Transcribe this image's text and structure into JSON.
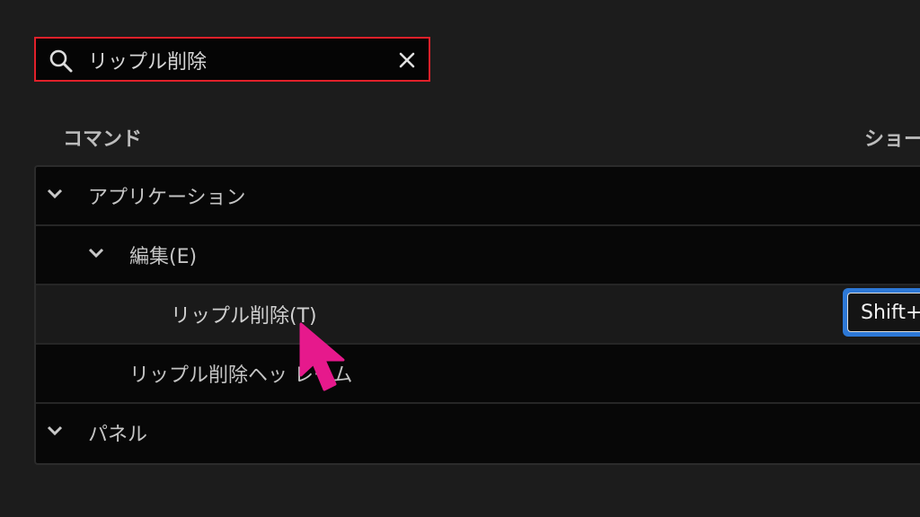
{
  "search": {
    "value": "リップル削除",
    "icon": "search-icon",
    "clear_icon": "close-icon",
    "highlight_color": "#e0202a"
  },
  "columns": {
    "command": "コマンド",
    "shortcut": "ショー"
  },
  "rows": [
    {
      "label": "アプリケーション",
      "expanded": true
    },
    {
      "label": "編集(E)",
      "expanded": true
    },
    {
      "label": "リップル削除(T)",
      "shortcut": "Shift+",
      "selected": true
    },
    {
      "label": "リップル削除ヘッ レーム"
    },
    {
      "label": "パネル",
      "expanded": true
    }
  ],
  "cursor": {
    "icon": "mouse-pointer-icon",
    "color": "#e6198c"
  }
}
